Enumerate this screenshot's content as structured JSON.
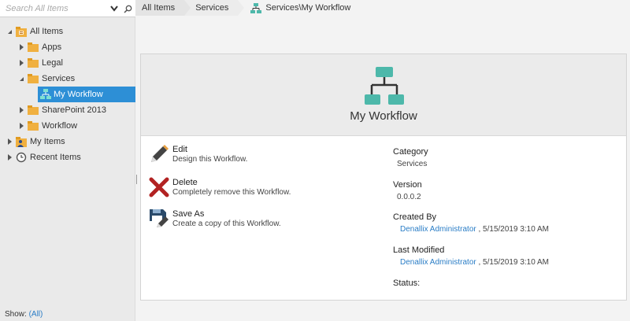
{
  "search": {
    "placeholder": "Search All Items"
  },
  "tree": {
    "all_items": "All Items",
    "apps": "Apps",
    "legal": "Legal",
    "services": "Services",
    "my_workflow": "My Workflow",
    "sharepoint": "SharePoint 2013",
    "workflow": "Workflow",
    "my_items": "My Items",
    "recent_items": "Recent Items"
  },
  "footer": {
    "show_label": "Show:",
    "show_value": "(All)"
  },
  "breadcrumb": {
    "c1": "All Items",
    "c2": "Services",
    "c3": "Services\\My Workflow"
  },
  "card": {
    "title": "My Workflow",
    "actions": [
      {
        "name": "Edit",
        "desc": "Design this Workflow."
      },
      {
        "name": "Delete",
        "desc": "Completely remove this Workflow."
      },
      {
        "name": "Save As",
        "desc": "Create a copy of this Workflow."
      }
    ],
    "props": {
      "category_label": "Category",
      "category_value": "Services",
      "version_label": "Version",
      "version_value": "0.0.0.2",
      "created_label": "Created By",
      "created_user": "Denallix Administrator",
      "created_date": ", 5/15/2019 3:10 AM",
      "modified_label": "Last Modified",
      "modified_user": "Denallix Administrator",
      "modified_date": ", 5/15/2019 3:10 AM",
      "status_label": "Status:"
    }
  },
  "colors": {
    "selected": "#2d8fd6",
    "teal": "#4db8aa",
    "folder": "#f0b040",
    "delete": "#b22222",
    "link": "#2a7dc6"
  }
}
